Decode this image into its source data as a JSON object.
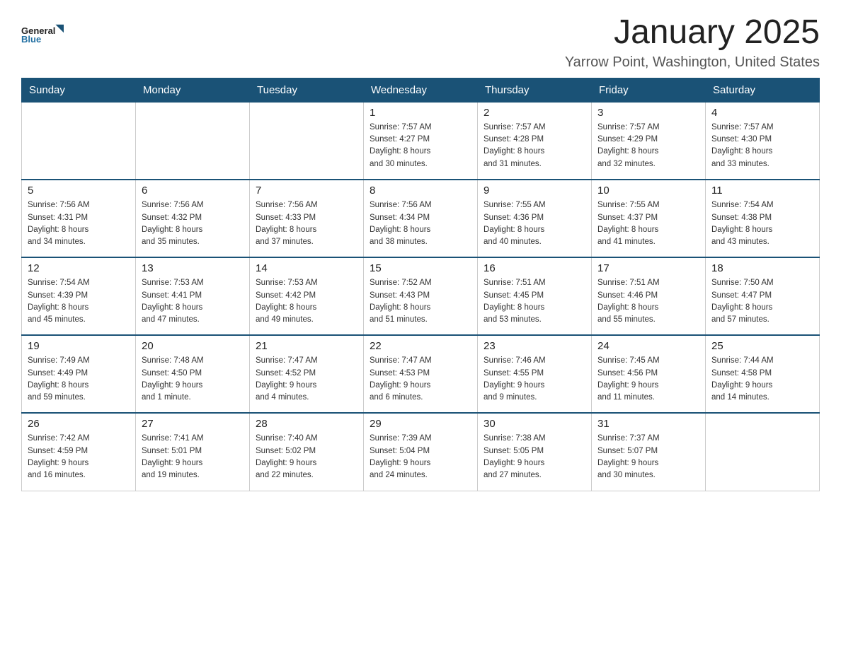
{
  "header": {
    "title": "January 2025",
    "subtitle": "Yarrow Point, Washington, United States",
    "logo": {
      "line1": "General",
      "line2": "Blue"
    }
  },
  "weekdays": [
    "Sunday",
    "Monday",
    "Tuesday",
    "Wednesday",
    "Thursday",
    "Friday",
    "Saturday"
  ],
  "weeks": [
    [
      {
        "day": "",
        "info": ""
      },
      {
        "day": "",
        "info": ""
      },
      {
        "day": "",
        "info": ""
      },
      {
        "day": "1",
        "info": "Sunrise: 7:57 AM\nSunset: 4:27 PM\nDaylight: 8 hours\nand 30 minutes."
      },
      {
        "day": "2",
        "info": "Sunrise: 7:57 AM\nSunset: 4:28 PM\nDaylight: 8 hours\nand 31 minutes."
      },
      {
        "day": "3",
        "info": "Sunrise: 7:57 AM\nSunset: 4:29 PM\nDaylight: 8 hours\nand 32 minutes."
      },
      {
        "day": "4",
        "info": "Sunrise: 7:57 AM\nSunset: 4:30 PM\nDaylight: 8 hours\nand 33 minutes."
      }
    ],
    [
      {
        "day": "5",
        "info": "Sunrise: 7:56 AM\nSunset: 4:31 PM\nDaylight: 8 hours\nand 34 minutes."
      },
      {
        "day": "6",
        "info": "Sunrise: 7:56 AM\nSunset: 4:32 PM\nDaylight: 8 hours\nand 35 minutes."
      },
      {
        "day": "7",
        "info": "Sunrise: 7:56 AM\nSunset: 4:33 PM\nDaylight: 8 hours\nand 37 minutes."
      },
      {
        "day": "8",
        "info": "Sunrise: 7:56 AM\nSunset: 4:34 PM\nDaylight: 8 hours\nand 38 minutes."
      },
      {
        "day": "9",
        "info": "Sunrise: 7:55 AM\nSunset: 4:36 PM\nDaylight: 8 hours\nand 40 minutes."
      },
      {
        "day": "10",
        "info": "Sunrise: 7:55 AM\nSunset: 4:37 PM\nDaylight: 8 hours\nand 41 minutes."
      },
      {
        "day": "11",
        "info": "Sunrise: 7:54 AM\nSunset: 4:38 PM\nDaylight: 8 hours\nand 43 minutes."
      }
    ],
    [
      {
        "day": "12",
        "info": "Sunrise: 7:54 AM\nSunset: 4:39 PM\nDaylight: 8 hours\nand 45 minutes."
      },
      {
        "day": "13",
        "info": "Sunrise: 7:53 AM\nSunset: 4:41 PM\nDaylight: 8 hours\nand 47 minutes."
      },
      {
        "day": "14",
        "info": "Sunrise: 7:53 AM\nSunset: 4:42 PM\nDaylight: 8 hours\nand 49 minutes."
      },
      {
        "day": "15",
        "info": "Sunrise: 7:52 AM\nSunset: 4:43 PM\nDaylight: 8 hours\nand 51 minutes."
      },
      {
        "day": "16",
        "info": "Sunrise: 7:51 AM\nSunset: 4:45 PM\nDaylight: 8 hours\nand 53 minutes."
      },
      {
        "day": "17",
        "info": "Sunrise: 7:51 AM\nSunset: 4:46 PM\nDaylight: 8 hours\nand 55 minutes."
      },
      {
        "day": "18",
        "info": "Sunrise: 7:50 AM\nSunset: 4:47 PM\nDaylight: 8 hours\nand 57 minutes."
      }
    ],
    [
      {
        "day": "19",
        "info": "Sunrise: 7:49 AM\nSunset: 4:49 PM\nDaylight: 8 hours\nand 59 minutes."
      },
      {
        "day": "20",
        "info": "Sunrise: 7:48 AM\nSunset: 4:50 PM\nDaylight: 9 hours\nand 1 minute."
      },
      {
        "day": "21",
        "info": "Sunrise: 7:47 AM\nSunset: 4:52 PM\nDaylight: 9 hours\nand 4 minutes."
      },
      {
        "day": "22",
        "info": "Sunrise: 7:47 AM\nSunset: 4:53 PM\nDaylight: 9 hours\nand 6 minutes."
      },
      {
        "day": "23",
        "info": "Sunrise: 7:46 AM\nSunset: 4:55 PM\nDaylight: 9 hours\nand 9 minutes."
      },
      {
        "day": "24",
        "info": "Sunrise: 7:45 AM\nSunset: 4:56 PM\nDaylight: 9 hours\nand 11 minutes."
      },
      {
        "day": "25",
        "info": "Sunrise: 7:44 AM\nSunset: 4:58 PM\nDaylight: 9 hours\nand 14 minutes."
      }
    ],
    [
      {
        "day": "26",
        "info": "Sunrise: 7:42 AM\nSunset: 4:59 PM\nDaylight: 9 hours\nand 16 minutes."
      },
      {
        "day": "27",
        "info": "Sunrise: 7:41 AM\nSunset: 5:01 PM\nDaylight: 9 hours\nand 19 minutes."
      },
      {
        "day": "28",
        "info": "Sunrise: 7:40 AM\nSunset: 5:02 PM\nDaylight: 9 hours\nand 22 minutes."
      },
      {
        "day": "29",
        "info": "Sunrise: 7:39 AM\nSunset: 5:04 PM\nDaylight: 9 hours\nand 24 minutes."
      },
      {
        "day": "30",
        "info": "Sunrise: 7:38 AM\nSunset: 5:05 PM\nDaylight: 9 hours\nand 27 minutes."
      },
      {
        "day": "31",
        "info": "Sunrise: 7:37 AM\nSunset: 5:07 PM\nDaylight: 9 hours\nand 30 minutes."
      },
      {
        "day": "",
        "info": ""
      }
    ]
  ]
}
